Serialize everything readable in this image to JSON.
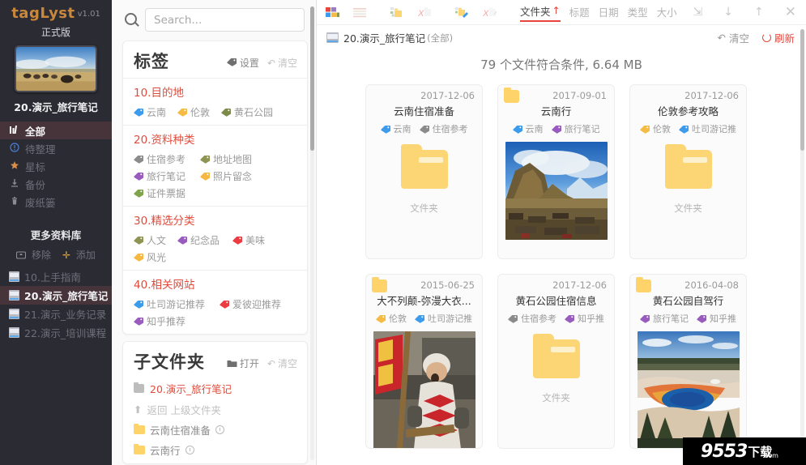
{
  "sidebar": {
    "brand_name": "tagLyst",
    "brand_version": "v1.01",
    "edition": "正式版",
    "library_title": "20.演示_旅行笔记",
    "nav": [
      {
        "label": "全部",
        "icon": "library-icon",
        "active": true
      },
      {
        "label": "待整理",
        "icon": "exclamation-circle-icon",
        "active": false
      },
      {
        "label": "星标",
        "icon": "star-icon",
        "active": false
      },
      {
        "label": "备份",
        "icon": "download-icon",
        "active": false
      },
      {
        "label": "废纸篓",
        "icon": "trash-icon",
        "active": false
      }
    ],
    "more_title": "更多资料库",
    "action_remove": "移除",
    "action_add": "添加",
    "libraries": [
      {
        "label": "10.上手指南",
        "active": false
      },
      {
        "label": "20.演示_旅行笔记",
        "active": true
      },
      {
        "label": "21.演示_业务记录",
        "active": false
      },
      {
        "label": "22.演示_培训课程",
        "active": false
      }
    ]
  },
  "search": {
    "placeholder": "Search...",
    "value": ""
  },
  "tags_panel": {
    "title": "标签",
    "action_settings": "设置",
    "action_clear": "清空",
    "groups": [
      {
        "title": "10.目的地",
        "tags": [
          {
            "label": "云南",
            "color": "#3d9bec"
          },
          {
            "label": "伦敦",
            "color": "#f5bb42"
          },
          {
            "label": "黄石公园",
            "color": "#7d8b4a"
          }
        ]
      },
      {
        "title": "20.资料种类",
        "tags": [
          {
            "label": "住宿参考",
            "color": "#8b8b8b"
          },
          {
            "label": "地址地图",
            "color": "#8e9452"
          },
          {
            "label": "旅行笔记",
            "color": "#9a5bbf"
          },
          {
            "label": "照片留念",
            "color": "#f5b942"
          },
          {
            "label": "证件票据",
            "color": "#7fa34a"
          }
        ]
      },
      {
        "title": "30.精选分类",
        "tags": [
          {
            "label": "人文",
            "color": "#8e9452"
          },
          {
            "label": "纪念品",
            "color": "#9a5bbf"
          },
          {
            "label": "美味",
            "color": "#ec3b41"
          },
          {
            "label": "风光",
            "color": "#f5b942"
          }
        ]
      },
      {
        "title": "40.相关网站",
        "tags": [
          {
            "label": "吐司游记推荐",
            "color": "#3d9bec"
          },
          {
            "label": "爱彼迎推荐",
            "color": "#ec3b41"
          },
          {
            "label": "知乎推荐",
            "color": "#9a5bbf"
          }
        ]
      }
    ]
  },
  "subfolder_panel": {
    "title": "子文件夹",
    "action_open": "打开",
    "action_clear": "清空",
    "current": "20.演示_旅行笔记",
    "back_label": "返回 上级文件夹",
    "items": [
      {
        "label": "云南住宿准备"
      },
      {
        "label": "云南行"
      }
    ]
  },
  "toolbar": {
    "icons": [
      {
        "name": "grid-view-icon"
      },
      {
        "name": "list-view-icon"
      },
      {
        "name": "add-tag-icon"
      },
      {
        "name": "remove-tag-icon"
      },
      {
        "name": "edit-tag-icon"
      },
      {
        "name": "clear-tag-icon"
      }
    ],
    "sorts": [
      {
        "label": "文件夹",
        "active": true,
        "arrow": "↑"
      },
      {
        "label": "标题",
        "active": false
      },
      {
        "label": "日期",
        "active": false
      },
      {
        "label": "类型",
        "active": false
      },
      {
        "label": "大小",
        "active": false
      }
    ],
    "window_controls": [
      {
        "name": "minimize-restore-icon",
        "glyph": "⇲"
      },
      {
        "name": "minimize-icon",
        "glyph": "↓"
      },
      {
        "name": "maximize-icon",
        "glyph": "↑"
      },
      {
        "name": "close-icon",
        "glyph": "✕"
      }
    ]
  },
  "breadcrumb": {
    "library": "20.演示_旅行笔记",
    "scope": "(全部)",
    "action_clear": "清空",
    "action_refresh": "刷新"
  },
  "summary": "79 个文件符合条件, 6.64 MB",
  "files": [
    {
      "date": "2017-12-06",
      "title": "云南住宿准备",
      "has_badge": false,
      "tags": [
        {
          "label": "云南",
          "color": "#3d9bec"
        },
        {
          "label": "住宿参考",
          "color": "#8b8b8b"
        }
      ],
      "preview": "folder",
      "preview_label": "文件夹"
    },
    {
      "date": "2017-09-01",
      "title": "云南行",
      "has_badge": true,
      "tags": [
        {
          "label": "云南",
          "color": "#3d9bec"
        },
        {
          "label": "旅行笔记",
          "color": "#9a5bbf"
        }
      ],
      "preview": "photo-lijiang",
      "preview_label": ""
    },
    {
      "date": "2017-12-06",
      "title": "伦敦参考攻略",
      "has_badge": false,
      "tags": [
        {
          "label": "伦敦",
          "color": "#f5bb42"
        },
        {
          "label": "吐司游记推",
          "color": "#3d9bec"
        }
      ],
      "preview": "folder",
      "preview_label": "文件夹"
    },
    {
      "date": "2015-06-25",
      "title": "大不列颠-弥漫大衣...",
      "has_badge": true,
      "tags": [
        {
          "label": "伦敦",
          "color": "#f5bb42"
        },
        {
          "label": "吐司游记推",
          "color": "#3d9bec"
        }
      ],
      "preview": "photo-knight",
      "preview_label": ""
    },
    {
      "date": "2017-12-06",
      "title": "黄石公园住宿信息",
      "has_badge": false,
      "tags": [
        {
          "label": "住宿参考",
          "color": "#8b8b8b"
        },
        {
          "label": "知乎推",
          "color": "#9a5bbf"
        }
      ],
      "preview": "folder",
      "preview_label": "文件夹"
    },
    {
      "date": "2016-04-08",
      "title": "黄石公园自驾行",
      "has_badge": true,
      "tags": [
        {
          "label": "旅行笔记",
          "color": "#9a5bbf"
        },
        {
          "label": "知乎推",
          "color": "#9a5bbf"
        }
      ],
      "preview": "photo-yellowstone",
      "preview_label": ""
    }
  ],
  "watermark": {
    "number": "9553",
    "cn": "下载",
    "domain": ".com"
  }
}
